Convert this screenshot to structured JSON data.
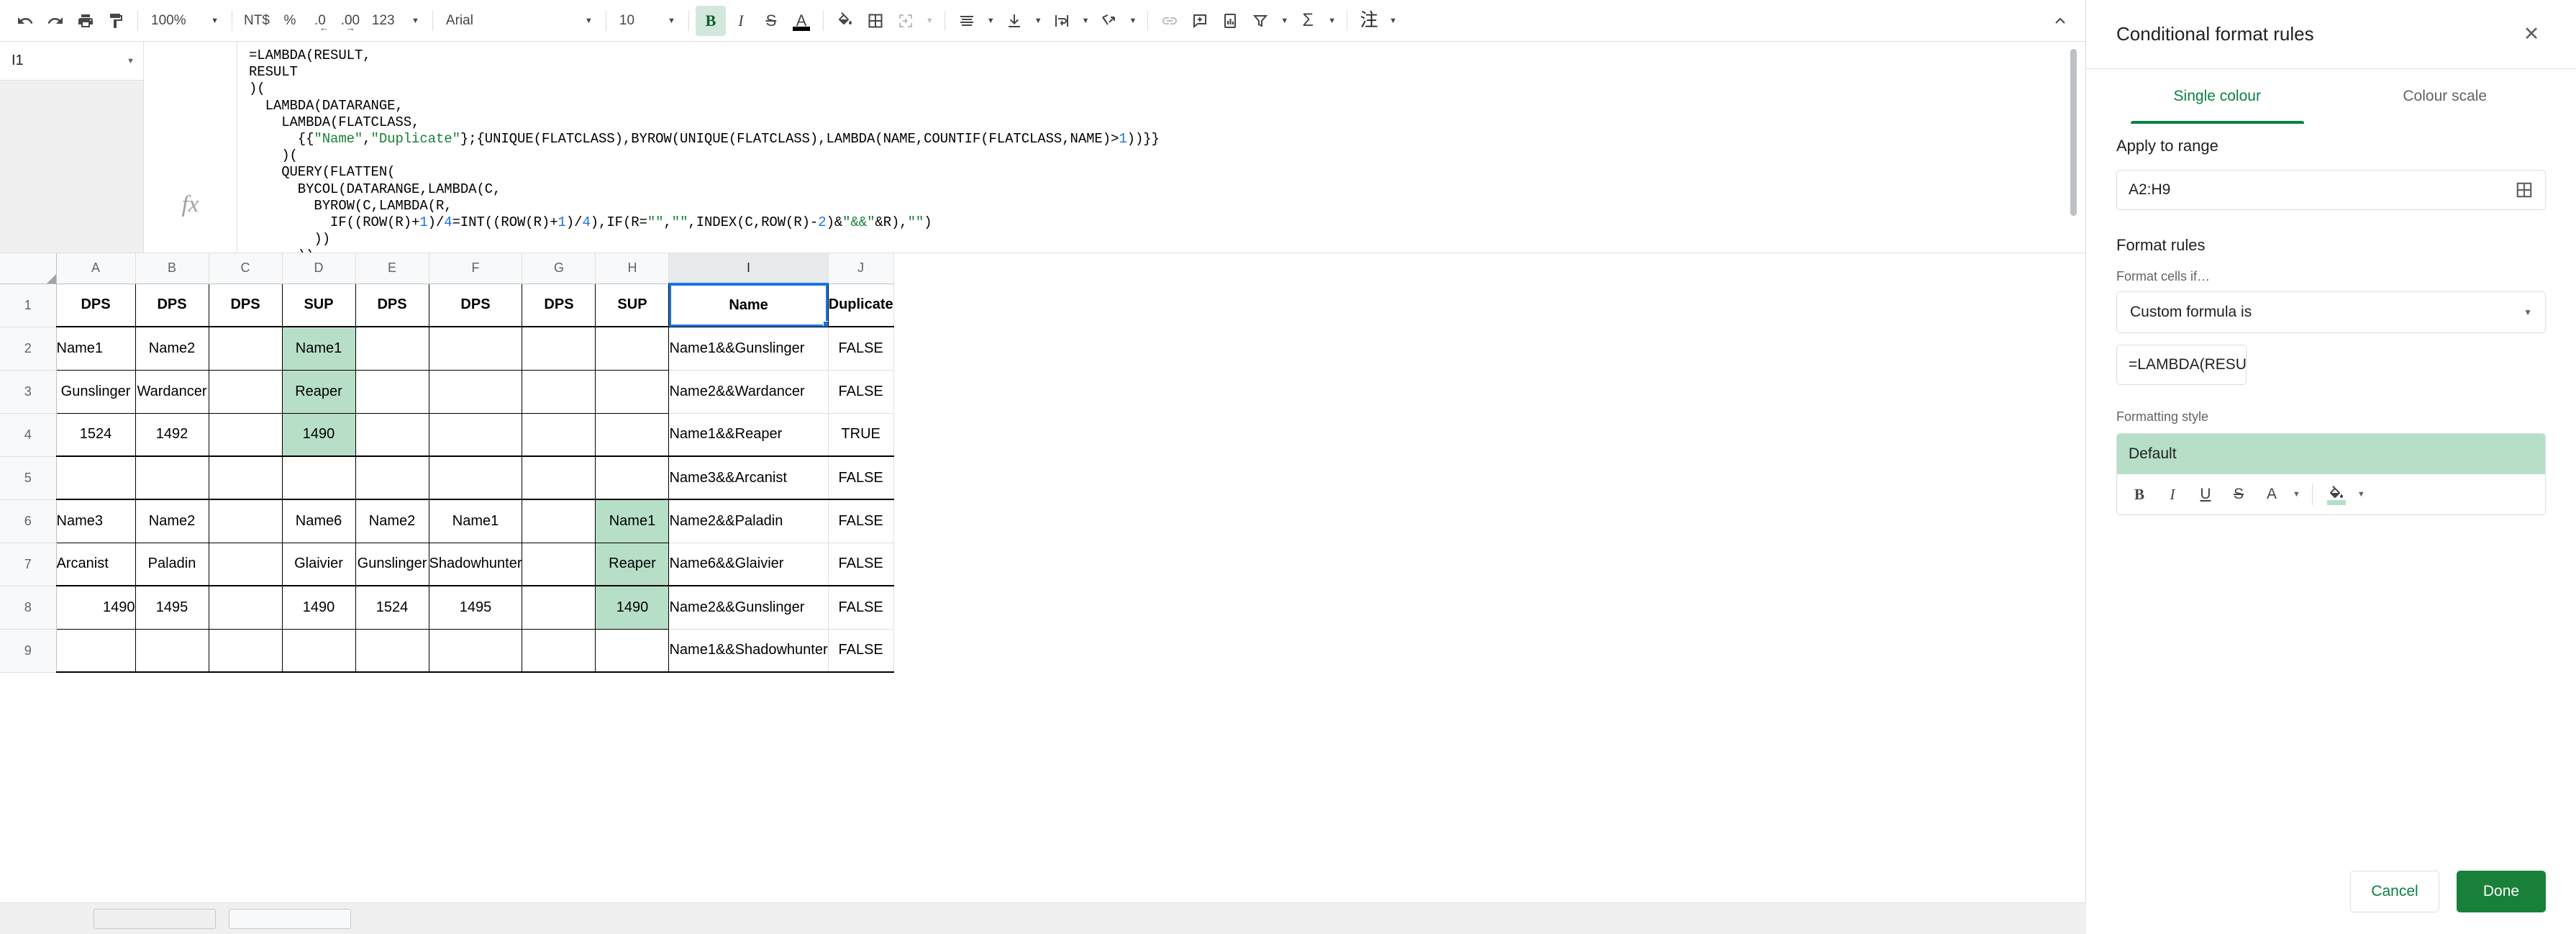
{
  "toolbar": {
    "undo_label": "undo-icon",
    "redo_label": "redo-icon",
    "print_label": "print-icon",
    "paint_label": "paint-format-icon",
    "zoom_value": "100%",
    "currency_label": "NT$",
    "percent_label": "%",
    "decrease_decimal_label": ".0",
    "increase_decimal_label": ".00",
    "number_format_label": "123",
    "font_value": "Arial",
    "font_size_value": "10",
    "bold_label": "B",
    "italic_label": "I",
    "strikethrough_label": "S",
    "text_color_label": "A",
    "fill_color_label": "fill-color-icon",
    "borders_label": "borders-icon",
    "merge_label": "merge-cells-icon",
    "halign_label": "horizontal-align-icon",
    "valign_label": "vertical-align-icon",
    "wrap_label": "text-wrap-icon",
    "rotate_label": "text-rotation-icon",
    "link_label": "insert-link-icon",
    "comment_label": "insert-comment-icon",
    "chart_label": "insert-chart-icon",
    "filter_label": "filter-icon",
    "functions_label": "functions-icon",
    "notes_label": "注",
    "collapse_label": "collapse-toolbar-icon"
  },
  "formula_bar": {
    "name_box_value": "I1",
    "fx_label": "fx",
    "lines": [
      [
        {
          "t": "=LAMBDA(RESULT,",
          "c": ""
        }
      ],
      [
        {
          "t": "RESULT",
          "c": ""
        }
      ],
      [
        {
          "t": ")(",
          "c": ""
        }
      ],
      [
        {
          "t": "  LAMBDA(DATARANGE,",
          "c": ""
        }
      ],
      [
        {
          "t": "    LAMBDA(FLATCLASS,",
          "c": ""
        }
      ],
      [
        {
          "t": "      {{",
          "c": ""
        },
        {
          "t": "\"Name\"",
          "c": "tk-str"
        },
        {
          "t": ",",
          "c": ""
        },
        {
          "t": "\"Duplicate\"",
          "c": "tk-str"
        },
        {
          "t": "};{UNIQUE(FLATCLASS),BYROW(UNIQUE(FLATCLASS),LAMBDA(NAME,COUNTIF(FLATCLASS,NAME)>",
          "c": ""
        },
        {
          "t": "1",
          "c": "tk-num"
        },
        {
          "t": "))}}",
          "c": ""
        }
      ],
      [
        {
          "t": "    )(",
          "c": ""
        }
      ],
      [
        {
          "t": "    QUERY(FLATTEN(",
          "c": ""
        }
      ],
      [
        {
          "t": "      BYCOL(DATARANGE,LAMBDA(C,",
          "c": ""
        }
      ],
      [
        {
          "t": "        BYROW(C,LAMBDA(R,",
          "c": ""
        }
      ],
      [
        {
          "t": "          IF((ROW(R)+",
          "c": ""
        },
        {
          "t": "1",
          "c": "tk-num"
        },
        {
          "t": ")/",
          "c": ""
        },
        {
          "t": "4",
          "c": "tk-num"
        },
        {
          "t": "=INT((ROW(R)+",
          "c": ""
        },
        {
          "t": "1",
          "c": "tk-num"
        },
        {
          "t": ")/",
          "c": ""
        },
        {
          "t": "4",
          "c": "tk-num"
        },
        {
          "t": "),IF(R=",
          "c": ""
        },
        {
          "t": "\"\"",
          "c": "tk-str"
        },
        {
          "t": ",",
          "c": ""
        },
        {
          "t": "\"\"",
          "c": "tk-str"
        },
        {
          "t": ",INDEX(C,ROW(R)-",
          "c": ""
        },
        {
          "t": "2",
          "c": "tk-num"
        },
        {
          "t": ")&",
          "c": ""
        },
        {
          "t": "\"&&\"",
          "c": "tk-str"
        },
        {
          "t": "&R),",
          "c": ""
        },
        {
          "t": "\"\"",
          "c": "tk-str"
        },
        {
          "t": ")",
          "c": ""
        }
      ],
      [
        {
          "t": "        ))",
          "c": ""
        }
      ],
      [
        {
          "t": "      ))",
          "c": ""
        }
      ]
    ]
  },
  "grid": {
    "column_headers": [
      "A",
      "B",
      "C",
      "D",
      "E",
      "F",
      "G",
      "H",
      "I",
      "J"
    ],
    "selected_column": "I",
    "row_headers": [
      "1",
      "2",
      "3",
      "4",
      "5",
      "6",
      "7",
      "8",
      "9"
    ],
    "selected_cell": "I1",
    "rows": [
      {
        "num": "1",
        "cells": [
          {
            "v": "DPS",
            "a": "c-center",
            "b": true
          },
          {
            "v": "DPS",
            "a": "c-center",
            "b": true
          },
          {
            "v": "DPS",
            "a": "c-center",
            "b": true
          },
          {
            "v": "SUP",
            "a": "c-center",
            "b": true
          },
          {
            "v": "DPS",
            "a": "c-center",
            "b": true
          },
          {
            "v": "DPS",
            "a": "c-center",
            "b": true
          },
          {
            "v": "DPS",
            "a": "c-center",
            "b": true
          },
          {
            "v": "SUP",
            "a": "c-center",
            "b": true
          },
          {
            "v": "Name",
            "a": "c-center",
            "b": true,
            "sel": true
          },
          {
            "v": "Duplicate",
            "a": "c-center",
            "b": true,
            "thin": true
          }
        ]
      },
      {
        "num": "2",
        "cells": [
          {
            "v": "Name1",
            "a": "c-left"
          },
          {
            "v": "Name2",
            "a": "c-center"
          },
          {
            "v": "",
            "a": "c-center"
          },
          {
            "v": "Name1",
            "a": "c-center",
            "hl": true
          },
          {
            "v": "",
            "a": "c-center"
          },
          {
            "v": "",
            "a": "c-center"
          },
          {
            "v": "",
            "a": "c-center"
          },
          {
            "v": "",
            "a": "c-center"
          },
          {
            "v": "Name1&&Gunslinger",
            "a": "c-left",
            "thin": true
          },
          {
            "v": "FALSE",
            "a": "c-center",
            "thin": true
          }
        ]
      },
      {
        "num": "3",
        "cells": [
          {
            "v": "Gunslinger",
            "a": "c-center"
          },
          {
            "v": "Wardancer",
            "a": "c-center"
          },
          {
            "v": "",
            "a": "c-center"
          },
          {
            "v": "Reaper",
            "a": "c-center",
            "hl": true
          },
          {
            "v": "",
            "a": "c-center"
          },
          {
            "v": "",
            "a": "c-center"
          },
          {
            "v": "",
            "a": "c-center"
          },
          {
            "v": "",
            "a": "c-center"
          },
          {
            "v": "Name2&&Wardancer",
            "a": "c-left",
            "thin": true
          },
          {
            "v": "FALSE",
            "a": "c-center",
            "thin": true
          }
        ]
      },
      {
        "num": "4",
        "cells": [
          {
            "v": "1524",
            "a": "c-center"
          },
          {
            "v": "1492",
            "a": "c-center"
          },
          {
            "v": "",
            "a": "c-center"
          },
          {
            "v": "1490",
            "a": "c-center",
            "hl": true
          },
          {
            "v": "",
            "a": "c-center"
          },
          {
            "v": "",
            "a": "c-center"
          },
          {
            "v": "",
            "a": "c-center"
          },
          {
            "v": "",
            "a": "c-center"
          },
          {
            "v": "Name1&&Reaper",
            "a": "c-left",
            "thin": true
          },
          {
            "v": "TRUE",
            "a": "c-center",
            "thin": true
          }
        ]
      },
      {
        "num": "5",
        "cells": [
          {
            "v": "",
            "a": "c-center"
          },
          {
            "v": "",
            "a": "c-center"
          },
          {
            "v": "",
            "a": "c-center"
          },
          {
            "v": "",
            "a": "c-center"
          },
          {
            "v": "",
            "a": "c-center"
          },
          {
            "v": "",
            "a": "c-center"
          },
          {
            "v": "",
            "a": "c-center"
          },
          {
            "v": "",
            "a": "c-center"
          },
          {
            "v": "Name3&&Arcanist",
            "a": "c-left",
            "thin": true
          },
          {
            "v": "FALSE",
            "a": "c-center",
            "thin": true
          }
        ]
      },
      {
        "num": "6",
        "cells": [
          {
            "v": "Name3",
            "a": "c-left"
          },
          {
            "v": "Name2",
            "a": "c-center"
          },
          {
            "v": "",
            "a": "c-center"
          },
          {
            "v": "Name6",
            "a": "c-center"
          },
          {
            "v": "Name2",
            "a": "c-center"
          },
          {
            "v": "Name1",
            "a": "c-center"
          },
          {
            "v": "",
            "a": "c-center"
          },
          {
            "v": "Name1",
            "a": "c-center",
            "hl": true
          },
          {
            "v": "Name2&&Paladin",
            "a": "c-left",
            "thin": true
          },
          {
            "v": "FALSE",
            "a": "c-center",
            "thin": true
          }
        ]
      },
      {
        "num": "7",
        "cells": [
          {
            "v": "Arcanist",
            "a": "c-left"
          },
          {
            "v": "Paladin",
            "a": "c-center"
          },
          {
            "v": "",
            "a": "c-center"
          },
          {
            "v": "Glaivier",
            "a": "c-center"
          },
          {
            "v": "Gunslinger",
            "a": "c-center"
          },
          {
            "v": "Shadowhunter",
            "a": "c-center"
          },
          {
            "v": "",
            "a": "c-center"
          },
          {
            "v": "Reaper",
            "a": "c-center",
            "hl": true
          },
          {
            "v": "Name6&&Glaivier",
            "a": "c-left",
            "thin": true
          },
          {
            "v": "FALSE",
            "a": "c-center",
            "thin": true
          }
        ]
      },
      {
        "num": "8",
        "cells": [
          {
            "v": "1490",
            "a": "c-right"
          },
          {
            "v": "1495",
            "a": "c-center"
          },
          {
            "v": "",
            "a": "c-center"
          },
          {
            "v": "1490",
            "a": "c-center"
          },
          {
            "v": "1524",
            "a": "c-center"
          },
          {
            "v": "1495",
            "a": "c-center"
          },
          {
            "v": "",
            "a": "c-center"
          },
          {
            "v": "1490",
            "a": "c-center",
            "hl": true
          },
          {
            "v": "Name2&&Gunslinger",
            "a": "c-left",
            "thin": true
          },
          {
            "v": "FALSE",
            "a": "c-center",
            "thin": true
          }
        ]
      },
      {
        "num": "9",
        "cells": [
          {
            "v": "",
            "a": "c-center"
          },
          {
            "v": "",
            "a": "c-center"
          },
          {
            "v": "",
            "a": "c-center"
          },
          {
            "v": "",
            "a": "c-center"
          },
          {
            "v": "",
            "a": "c-center"
          },
          {
            "v": "",
            "a": "c-center"
          },
          {
            "v": "",
            "a": "c-center"
          },
          {
            "v": "",
            "a": "c-center"
          },
          {
            "v": "Name1&&Shadowhunter",
            "a": "c-left",
            "thin": true
          },
          {
            "v": "FALSE",
            "a": "c-center",
            "thin": true
          }
        ]
      }
    ]
  },
  "panel": {
    "title": "Conditional format rules",
    "close_label": "✕",
    "tabs": [
      {
        "label": "Single colour",
        "active": true
      },
      {
        "label": "Colour scale",
        "active": false
      }
    ],
    "apply_to_range_heading": "Apply to range",
    "apply_to_range_value": "A2:H9",
    "range_picker_label": "select-data-range-icon",
    "format_rules_heading": "Format rules",
    "format_cells_if_label": "Format cells if…",
    "condition_value": "Custom formula is",
    "custom_formula_value": "=LAMBDA(RESULT,  LAMB",
    "formatting_style_heading": "Formatting style",
    "style_preview_text": "Default",
    "style_tools": {
      "bold": "B",
      "italic": "I",
      "underline": "U",
      "strikethrough": "S",
      "text_color": "A",
      "fill_color": "fill-color-icon"
    },
    "cancel_label": "Cancel",
    "done_label": "Done",
    "accent_color": "#188038",
    "highlight_color": "#b7dfc7"
  },
  "sheet_bottom": {
    "tab_a": "sheet-tab-placeholder-1",
    "tab_b": "sheet-tab-placeholder-2"
  }
}
